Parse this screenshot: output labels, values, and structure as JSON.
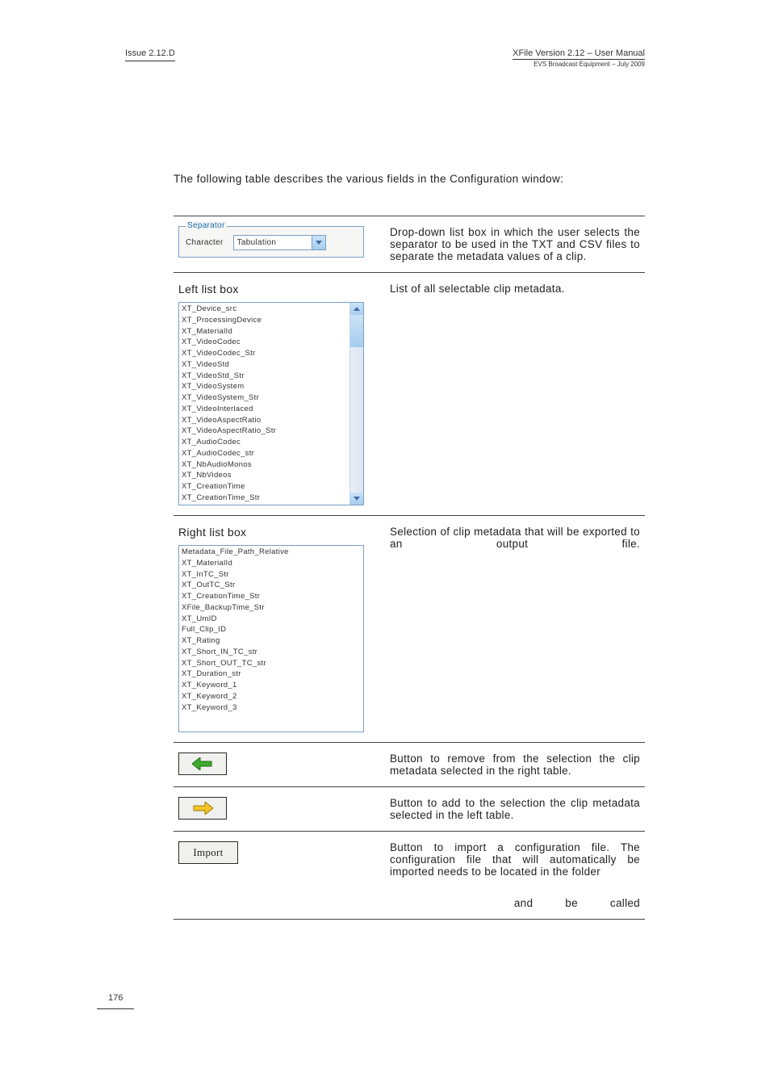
{
  "header": {
    "issue": "Issue 2.12.D",
    "title": "XFile Version 2.12 – User Manual",
    "subtitle": "EVS Broadcast Equipment – July 2009"
  },
  "intro": "The following table describes the various fields in the Configuration window:",
  "rows": {
    "separator": {
      "legend": "Separator",
      "label": "Character",
      "value": "Tabulation",
      "desc": "Drop-down list box in which the user selects the separator to be used in the TXT and CSV files to separate the metadata values of a clip."
    },
    "leftlist": {
      "title": "Left list box",
      "desc": "List of all selectable clip metadata.",
      "items": [
        "XT_Device_src",
        "XT_ProcessingDevice",
        "XT_MaterialId",
        "XT_VideoCodec",
        "XT_VideoCodec_Str",
        "XT_VideoStd",
        "XT_VideoStd_Str",
        "XT_VideoSystem",
        "XT_VideoSystem_Str",
        "XT_VideoInterlaced",
        "XT_VideoAspectRatio",
        "XT_VideoAspectRatio_Str",
        "XT_AudioCodec",
        "XT_AudioCodec_str",
        "XT_NbAudioMonos",
        "XT_NbVideos",
        "XT_CreationTime",
        "XT_CreationTime_Str"
      ]
    },
    "rightlist": {
      "title": "Right list box",
      "desc": "Selection of clip metadata that will be exported to an output file.",
      "items": [
        "Metadata_File_Path_Relative",
        "XT_MaterialId",
        "XT_InTC_Str",
        "XT_OutTC_Str",
        "XT_CreationTime_Str",
        "XFile_BackupTime_Str",
        "XT_UmID",
        "Full_Clip_ID",
        "XT_Rating",
        "XT_Short_IN_TC_str",
        "XT_Short_OUT_TC_str",
        "XT_Duration_str",
        "XT_Keyword_1",
        "XT_Keyword_2",
        "XT_Keyword_3"
      ]
    },
    "remove": {
      "desc": "Button to remove from the selection the clip metadata selected in the right table."
    },
    "add": {
      "desc": "Button to add to the selection the clip metadata selected in the left table."
    },
    "import": {
      "label": "Import",
      "desc1": "Button to import a configuration file. The configuration file that will automatically be imported needs to be located in the folder",
      "desc2a": "and",
      "desc2b": "be",
      "desc2c": "called"
    }
  },
  "page_number": "176"
}
